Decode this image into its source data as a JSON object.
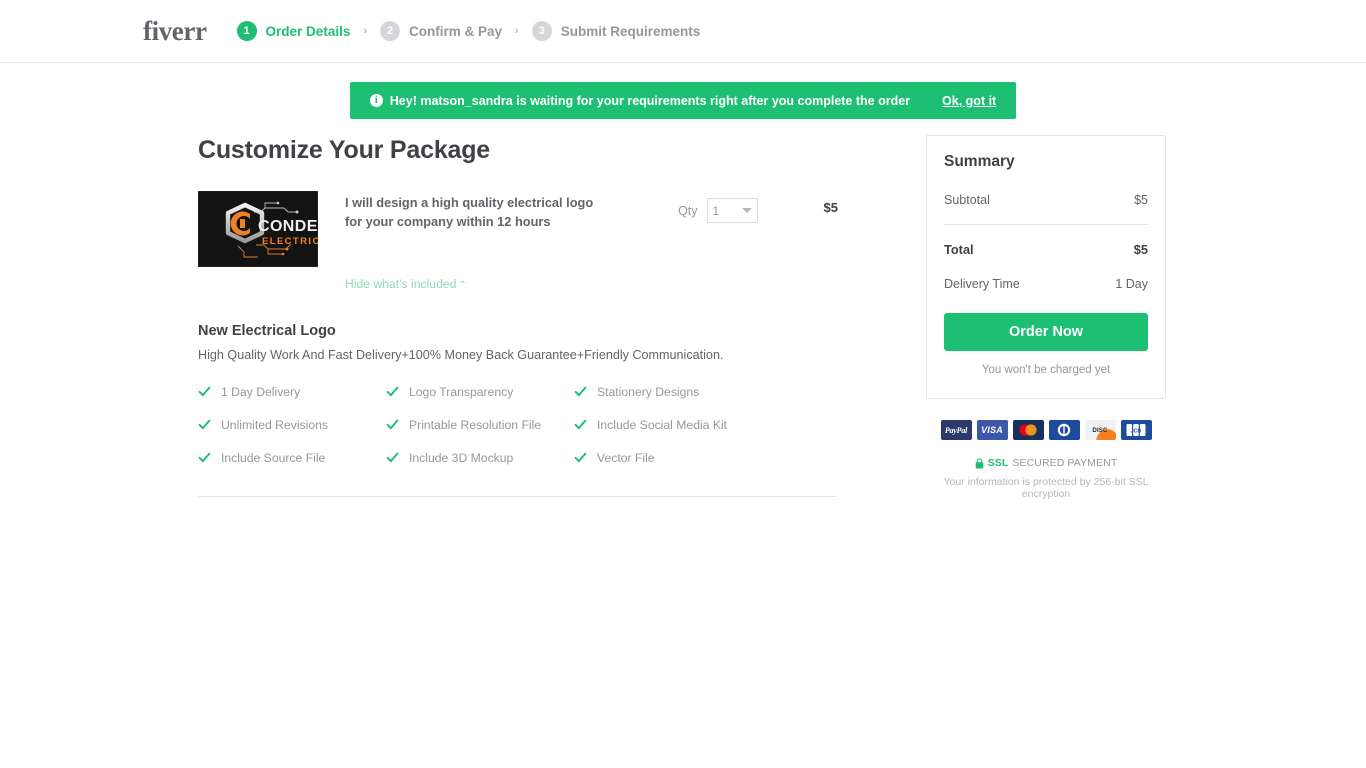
{
  "header": {
    "logo": "fiverr",
    "steps": [
      {
        "number": "1",
        "label": "Order Details",
        "state": "active"
      },
      {
        "number": "2",
        "label": "Confirm & Pay",
        "state": "inactive"
      },
      {
        "number": "3",
        "label": "Submit Requirements",
        "state": "inactive"
      }
    ],
    "separator": "›"
  },
  "notice": {
    "icon": "info-icon",
    "glyph": "i",
    "message": "Hey! matson_sandra is waiting for your requirements right after you complete the order",
    "action_label": "Ok, got it",
    "background": "#1dbf73"
  },
  "main": {
    "page_title": "Customize Your Package",
    "gig": {
      "title": "I will design a high quality electrical logo for your company within 12 hours",
      "thumbnail_alt": "CONDE ELECTRIC logo",
      "thumbnail_text_primary": "CONDE",
      "thumbnail_text_secondary": "ELECTRIC",
      "toggle_label": "Hide what's included",
      "toggle_caret": "⌃",
      "qty_label": "Qty",
      "qty_value": "1",
      "price": "$5"
    },
    "package": {
      "name": "New Electrical Logo",
      "description": "High Quality Work And Fast Delivery+100% Money Back Guarantee+Friendly Communication.",
      "features": [
        "1 Day Delivery",
        "Logo Transparency",
        "Stationery Designs",
        "Unlimited Revisions",
        "Printable Resolution File",
        "Include Social Media Kit",
        "Include Source File",
        "Include 3D Mockup",
        "Vector File"
      ]
    }
  },
  "summary": {
    "title": "Summary",
    "subtotal_label": "Subtotal",
    "subtotal_value": "$5",
    "total_label": "Total",
    "total_value": "$5",
    "delivery_label": "Delivery Time",
    "delivery_value": "1 Day",
    "order_button": "Order Now",
    "charge_note": "You won't be charged yet"
  },
  "payments": {
    "methods": [
      {
        "name": "paypal-icon",
        "label": "PayPal"
      },
      {
        "name": "visa-icon",
        "label": "VISA"
      },
      {
        "name": "mastercard-icon",
        "label": "Mastercard"
      },
      {
        "name": "diners-club-icon",
        "label": "Diners Club"
      },
      {
        "name": "discover-icon",
        "label": "DISC"
      },
      {
        "name": "jcb-icon",
        "label": "JCB"
      }
    ]
  },
  "security": {
    "lock_icon": "lock-icon",
    "ssl_label": "SSL",
    "secured_label": "SECURED PAYMENT",
    "note": "Your information is protected by 256-bit SSL encryption"
  },
  "colors": {
    "brand_green": "#1dbf73",
    "text_dark": "#404145",
    "text_muted": "#95979d",
    "border": "#e4e5e7"
  }
}
